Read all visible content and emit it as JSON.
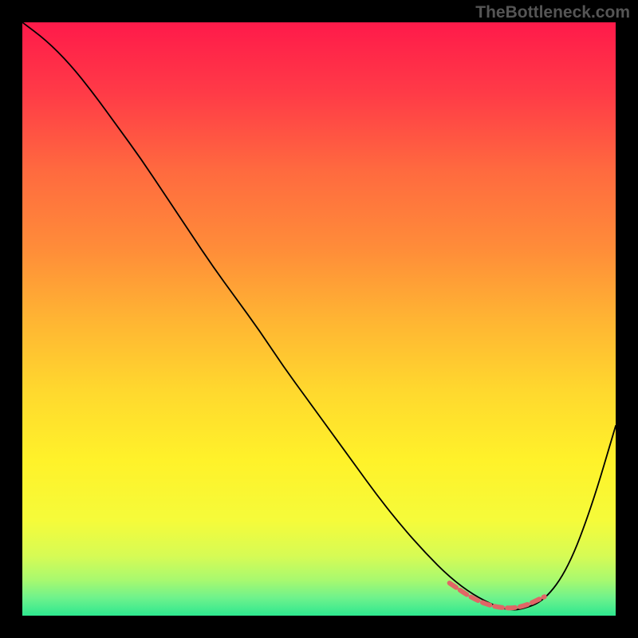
{
  "watermark": "TheBottleneck.com",
  "chart_data": {
    "type": "line",
    "title": "",
    "xlabel": "",
    "ylabel": "",
    "xlim": [
      0,
      100
    ],
    "ylim": [
      0,
      100
    ],
    "background": {
      "type": "vertical-gradient",
      "stops": [
        {
          "offset": 0.0,
          "color": "#FF1A4A"
        },
        {
          "offset": 0.12,
          "color": "#FF3B47"
        },
        {
          "offset": 0.25,
          "color": "#FF6A3F"
        },
        {
          "offset": 0.38,
          "color": "#FF8C39"
        },
        {
          "offset": 0.5,
          "color": "#FFB433"
        },
        {
          "offset": 0.62,
          "color": "#FFD82E"
        },
        {
          "offset": 0.74,
          "color": "#FFF22A"
        },
        {
          "offset": 0.84,
          "color": "#F5FB3A"
        },
        {
          "offset": 0.9,
          "color": "#D6FB55"
        },
        {
          "offset": 0.94,
          "color": "#A8F96F"
        },
        {
          "offset": 0.97,
          "color": "#6EF28C"
        },
        {
          "offset": 1.0,
          "color": "#2EE88F"
        }
      ]
    },
    "series": [
      {
        "name": "bottleneck-curve",
        "color": "#000000",
        "stroke_width": 1.8,
        "x": [
          0,
          4,
          8,
          12,
          16,
          20,
          24,
          28,
          32,
          36,
          40,
          44,
          48,
          52,
          56,
          60,
          64,
          68,
          72,
          76,
          80,
          82,
          84,
          88,
          92,
          96,
          100
        ],
        "y": [
          100,
          97,
          93,
          88,
          82.5,
          77,
          71,
          65,
          59,
          53.5,
          48,
          42,
          36.5,
          31,
          25.5,
          20,
          15,
          10.5,
          6.5,
          3.5,
          1.5,
          1.0,
          1.0,
          2.5,
          8,
          18.5,
          32
        ]
      },
      {
        "name": "optimal-zone-marker",
        "color": "#E06666",
        "stroke_width": 6,
        "dash": "10 6",
        "x": [
          72,
          76,
          80,
          84,
          88
        ],
        "y": [
          5.5,
          2.8,
          1.3,
          1.3,
          3.2
        ]
      }
    ]
  }
}
